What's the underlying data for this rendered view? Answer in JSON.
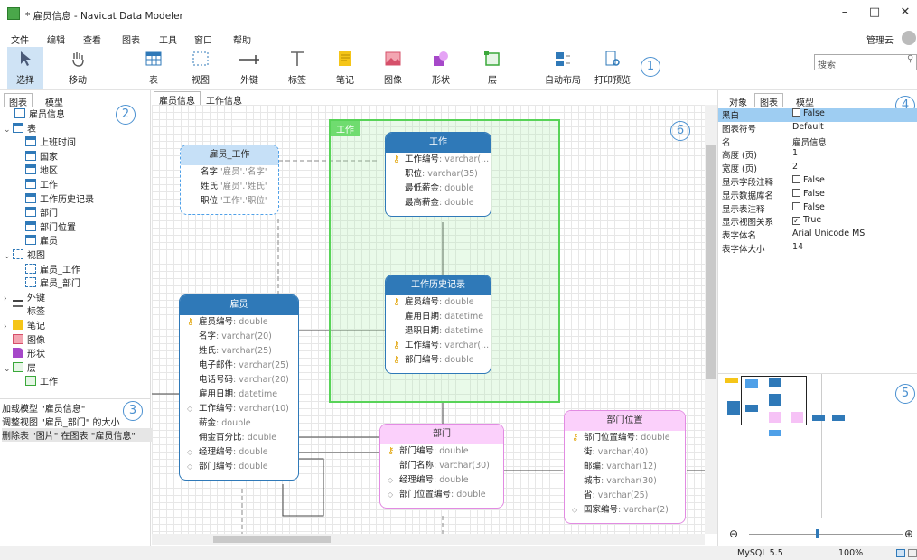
{
  "window": {
    "title": "* 雇员信息 - Navicat Data Modeler",
    "user": "管理云"
  },
  "menu": [
    "文件",
    "编辑",
    "查看",
    "图表",
    "工具",
    "窗口",
    "帮助"
  ],
  "toolbar": {
    "select": "选择",
    "move": "移动",
    "table": "表",
    "view": "视图",
    "fk": "外键",
    "label": "标签",
    "note": "笔记",
    "image": "图像",
    "shape": "形状",
    "layer": "层",
    "autolayout": "自动布局",
    "print": "打印预览",
    "search_placeholder": "搜索"
  },
  "markers": [
    "1",
    "2",
    "3",
    "4",
    "5",
    "6"
  ],
  "left": {
    "tabs": [
      "图表",
      "模型"
    ],
    "tree": [
      {
        "label": "雇员信息",
        "indent": 1,
        "icon": "diagram"
      },
      {
        "label": "表",
        "indent": 0,
        "icon": "table",
        "exp": "v"
      },
      {
        "label": "上班时间",
        "indent": 2,
        "icon": "table"
      },
      {
        "label": "国家",
        "indent": 2,
        "icon": "table"
      },
      {
        "label": "地区",
        "indent": 2,
        "icon": "table"
      },
      {
        "label": "工作",
        "indent": 2,
        "icon": "table"
      },
      {
        "label": "工作历史记录",
        "indent": 2,
        "icon": "table"
      },
      {
        "label": "部门",
        "indent": 2,
        "icon": "table"
      },
      {
        "label": "部门位置",
        "indent": 2,
        "icon": "table"
      },
      {
        "label": "雇员",
        "indent": 2,
        "icon": "table"
      },
      {
        "label": "视图",
        "indent": 0,
        "icon": "view",
        "exp": "v"
      },
      {
        "label": "雇员_工作",
        "indent": 2,
        "icon": "view"
      },
      {
        "label": "雇员_部门",
        "indent": 2,
        "icon": "view"
      },
      {
        "label": "外键",
        "indent": 0,
        "icon": "fk",
        "exp": ">"
      },
      {
        "label": "标签",
        "indent": 0,
        "icon": "label"
      },
      {
        "label": "笔记",
        "indent": 0,
        "icon": "note",
        "exp": ">"
      },
      {
        "label": "图像",
        "indent": 0,
        "icon": "image"
      },
      {
        "label": "形状",
        "indent": 0,
        "icon": "shape"
      },
      {
        "label": "层",
        "indent": 0,
        "icon": "layer",
        "exp": "v"
      },
      {
        "label": "工作",
        "indent": 2,
        "icon": "layer"
      }
    ],
    "log": [
      "加载模型 \"雇员信息\"",
      "调整视图 \"雇员_部门\" 的大小",
      "删除表 \"图片\" 在图表 \"雇员信息\""
    ]
  },
  "doc_tabs": [
    "雇员信息",
    "工作信息"
  ],
  "layer_name": "工作",
  "entities": {
    "view": {
      "title": "雇员_工作",
      "rows": [
        [
          "名字",
          "'雇员'.'名字'"
        ],
        [
          "姓氏",
          "'雇员'.'姓氏'"
        ],
        [
          "职位",
          "'工作'.'职位'"
        ]
      ]
    },
    "job": {
      "title": "工作",
      "rows": [
        [
          "k",
          "工作编号",
          ": varchar(..."
        ],
        [
          "",
          "职位",
          ": varchar(35)"
        ],
        [
          "",
          "最低薪金",
          ": double"
        ],
        [
          "",
          "最高薪金",
          ": double"
        ]
      ]
    },
    "hist": {
      "title": "工作历史记录",
      "rows": [
        [
          "k",
          "雇员编号",
          ": double"
        ],
        [
          "",
          "雇用日期",
          ": datetime"
        ],
        [
          "",
          "退职日期",
          ": datetime"
        ],
        [
          "k",
          "工作编号",
          ": varchar(..."
        ],
        [
          "k",
          "部门编号",
          ": double"
        ]
      ]
    },
    "emp": {
      "title": "雇员",
      "rows": [
        [
          "k",
          "雇员编号",
          ": double"
        ],
        [
          "",
          "名字",
          ": varchar(20)"
        ],
        [
          "",
          "姓氏",
          ": varchar(25)"
        ],
        [
          "",
          "电子邮件",
          ": varchar(25)"
        ],
        [
          "",
          "电话号码",
          ": varchar(20)"
        ],
        [
          "",
          "雇用日期",
          ": datetime"
        ],
        [
          "d",
          "工作编号",
          ": varchar(10)"
        ],
        [
          "",
          "薪金",
          ": double"
        ],
        [
          "",
          "佣金百分比",
          ": double"
        ],
        [
          "d",
          "经理编号",
          ": double"
        ],
        [
          "d",
          "部门编号",
          ": double"
        ]
      ]
    },
    "dept": {
      "title": "部门",
      "rows": [
        [
          "k",
          "部门编号",
          ": double"
        ],
        [
          "",
          "部门名称",
          ": varchar(30)"
        ],
        [
          "d",
          "经理编号",
          ": double"
        ],
        [
          "d",
          "部门位置编号",
          ": double"
        ]
      ]
    },
    "loc": {
      "title": "部门位置",
      "rows": [
        [
          "k",
          "部门位置编号",
          ": double"
        ],
        [
          "",
          "街",
          ": varchar(40)"
        ],
        [
          "",
          "邮编",
          ": varchar(12)"
        ],
        [
          "",
          "城市",
          ": varchar(30)"
        ],
        [
          "",
          "省",
          ": varchar(25)"
        ],
        [
          "d",
          "国家编号",
          ": varchar(2)"
        ]
      ]
    }
  },
  "right": {
    "tabs": [
      "对象",
      "图表",
      "模型"
    ],
    "props": [
      {
        "k": "黑白",
        "v": "False",
        "cb": "off",
        "hl": true
      },
      {
        "k": "图表符号",
        "v": "Default"
      },
      {
        "k": "名",
        "v": "雇员信息"
      },
      {
        "k": "高度 (页)",
        "v": "1"
      },
      {
        "k": "宽度 (页)",
        "v": "2"
      },
      {
        "k": "显示字段注释",
        "v": "False",
        "cb": "off"
      },
      {
        "k": "显示数据库名",
        "v": "False",
        "cb": "off"
      },
      {
        "k": "显示表注释",
        "v": "False",
        "cb": "off"
      },
      {
        "k": "显示视图关系",
        "v": "True",
        "cb": "on"
      },
      {
        "k": "表字体名",
        "v": "Arial Unicode MS"
      },
      {
        "k": "表字体大小",
        "v": "14"
      }
    ]
  },
  "status": {
    "db": "MySQL 5.5",
    "zoom": "100%"
  }
}
